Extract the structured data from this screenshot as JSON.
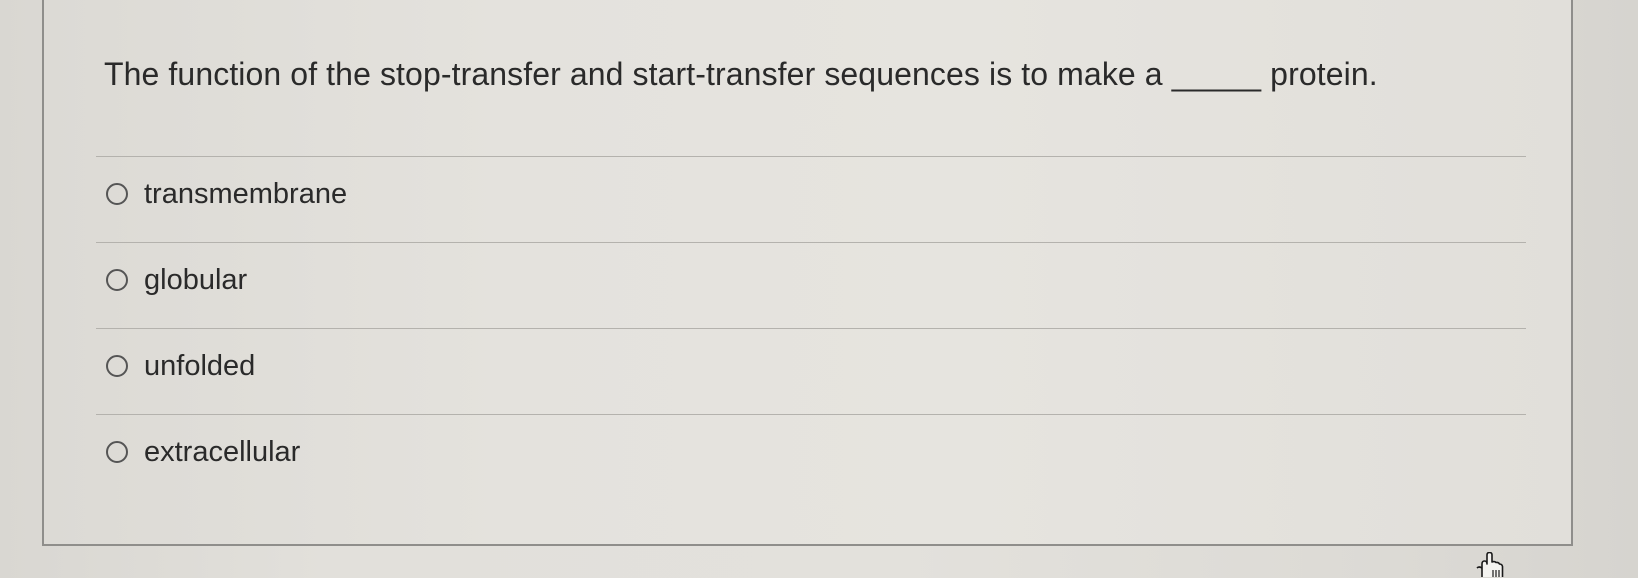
{
  "question": {
    "text": "The function of the stop-transfer and start-transfer sequences is to make a _____ protein."
  },
  "options": [
    {
      "label": "transmembrane",
      "selected": false
    },
    {
      "label": "globular",
      "selected": false
    },
    {
      "label": "unfolded",
      "selected": false
    },
    {
      "label": "extracellular",
      "selected": false
    }
  ],
  "cursor": {
    "icon": "hand-pointer-icon"
  }
}
